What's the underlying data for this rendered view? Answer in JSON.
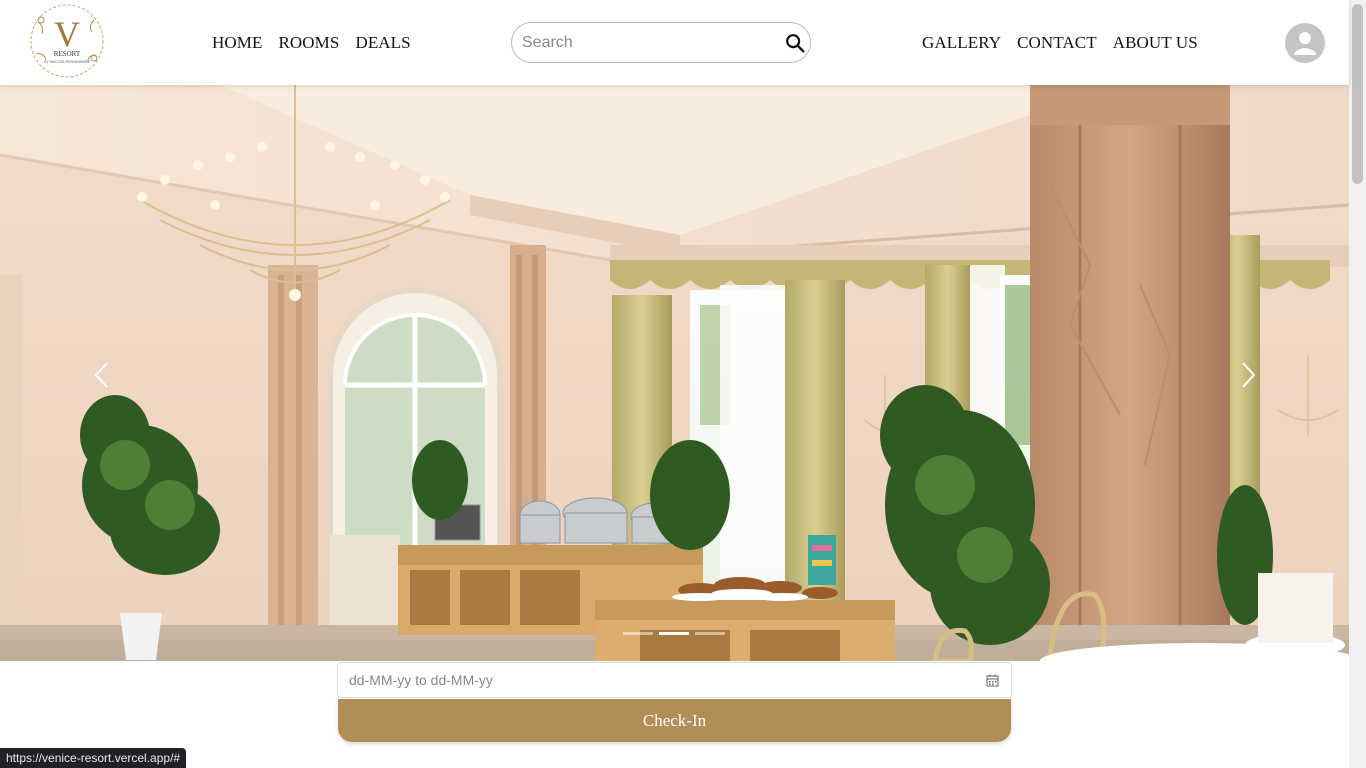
{
  "brand": {
    "logo_letter": "V",
    "logo_name": "RESORT",
    "logo_tagline": "BY HAKOOB RENNENBARE",
    "accent_color": "#b18d58"
  },
  "nav": {
    "left": [
      "HOME",
      "ROOMS",
      "DEALS"
    ],
    "right": [
      "GALLERY",
      "CONTACT",
      "ABOUT US"
    ]
  },
  "search": {
    "placeholder": "Search",
    "value": "",
    "icon": "search-icon"
  },
  "user": {
    "icon": "account-circle-icon"
  },
  "carousel": {
    "prev_icon": "chevron-left-icon",
    "next_icon": "chevron-right-icon",
    "slide_count": 3,
    "active_slide": 2
  },
  "booking": {
    "date_placeholder": "dd-MM-yy to dd-MM-yy",
    "date_value": "",
    "calendar_icon": "calendar-icon",
    "checkin_label": "Check-In"
  },
  "status_bar": {
    "url": "https://venice-resort.vercel.app/#"
  }
}
